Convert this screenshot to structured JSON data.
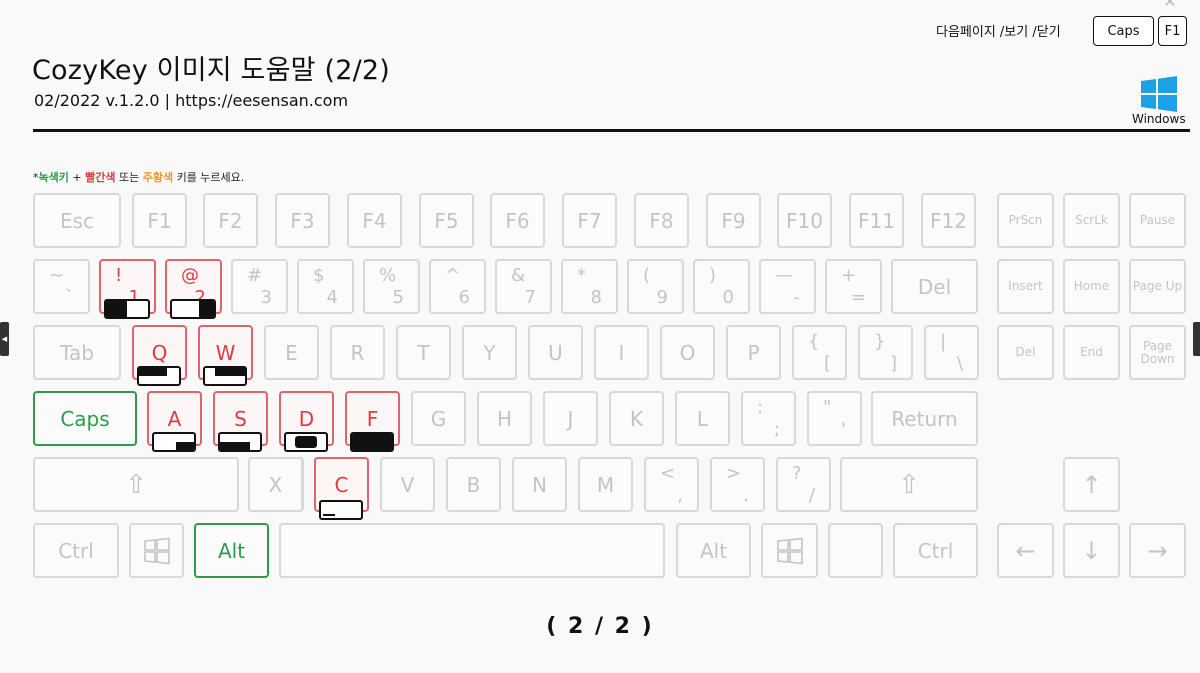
{
  "header": {
    "title": "CozyKey  이미지 도움말 (2/2)",
    "subtitle": "02/2022 v.1.2.0 | https://eesensan.com",
    "nav_text": "다음페이지 /보기 /닫기",
    "caps_button": "Caps",
    "f1_button": "F1",
    "os_label": "Windows"
  },
  "hint": {
    "prefix": "*",
    "green": "녹색키",
    "plus": " + ",
    "red": "빨간색",
    "middle": " 또는 ",
    "orange": "주황색",
    "suffix": " 키를 누르세요."
  },
  "keys": {
    "esc": "Esc",
    "f1": "F1",
    "f2": "F2",
    "f3": "F3",
    "f4": "F4",
    "f5": "F5",
    "f6": "F6",
    "f7": "F7",
    "f8": "F8",
    "f9": "F9",
    "f10": "F10",
    "f11": "F11",
    "f12": "F12",
    "prscn": "PrScn",
    "scrlk": "ScrLk",
    "pause": "Pause",
    "tilde_top": "~",
    "tilde_bot": "`",
    "k1_top": "!",
    "k1_bot": "1",
    "k2_top": "@",
    "k2_bot": "2",
    "k3_top": "#",
    "k3_bot": "3",
    "k4_top": "$",
    "k4_bot": "4",
    "k5_top": "%",
    "k5_bot": "5",
    "k6_top": "^",
    "k6_bot": "6",
    "k7_top": "&",
    "k7_bot": "7",
    "k8_top": "*",
    "k8_bot": "8",
    "k9_top": "(",
    "k9_bot": "9",
    "k0_top": ")",
    "k0_bot": "0",
    "minus_top": "—",
    "minus_bot": "-",
    "plus_top": "+",
    "plus_bot": "=",
    "del": "Del",
    "insert": "Insert",
    "home": "Home",
    "pageup": "Page Up",
    "tab": "Tab",
    "q": "Q",
    "w": "W",
    "e": "E",
    "r": "R",
    "t": "T",
    "y": "Y",
    "u": "U",
    "i": "I",
    "o": "O",
    "p": "P",
    "lbrace_top": "{",
    "lbrace_bot": "[",
    "rbrace_top": "}",
    "rbrace_bot": "]",
    "pipe_top": "|",
    "pipe_bot": "\\",
    "del2": "Del",
    "end": "End",
    "pagedown": "Page Down",
    "caps": "Caps",
    "a": "A",
    "s": "S",
    "d": "D",
    "f": "F",
    "g": "G",
    "h": "H",
    "j": "J",
    "k": "K",
    "l": "L",
    "colon_top": ":",
    "colon_bot": ";",
    "quote_top": "\"",
    "quote_bot": "'",
    "return": "Return",
    "shift_l": "⇧",
    "z": "Z",
    "x": "X",
    "c": "C",
    "v": "V",
    "b": "B",
    "n": "N",
    "m": "M",
    "lt_top": "<",
    "lt_bot": ",",
    "gt_top": ">",
    "gt_bot": ".",
    "q_top": "?",
    "q_bot": "/",
    "shift_r": "⇧",
    "up": "↑",
    "ctrl_l": "Ctrl",
    "alt_l": "Alt",
    "alt_r": "Alt",
    "ctrl_r": "Ctrl",
    "left": "←",
    "down": "↓",
    "right": "→"
  },
  "indicators": {
    "k1": 0.5,
    "k2": 0.35,
    "q": 0.7,
    "w": 0.75,
    "a": 0.45,
    "s": 0.75,
    "d": 0.55,
    "f": 1.0,
    "c": 0.3
  },
  "footer": {
    "page": "( 2 / 2 )"
  },
  "colors": {
    "green": "#2e9b4a",
    "red": "#e0393e",
    "orange": "#f0962b",
    "key_border": "#d8d8d8"
  }
}
